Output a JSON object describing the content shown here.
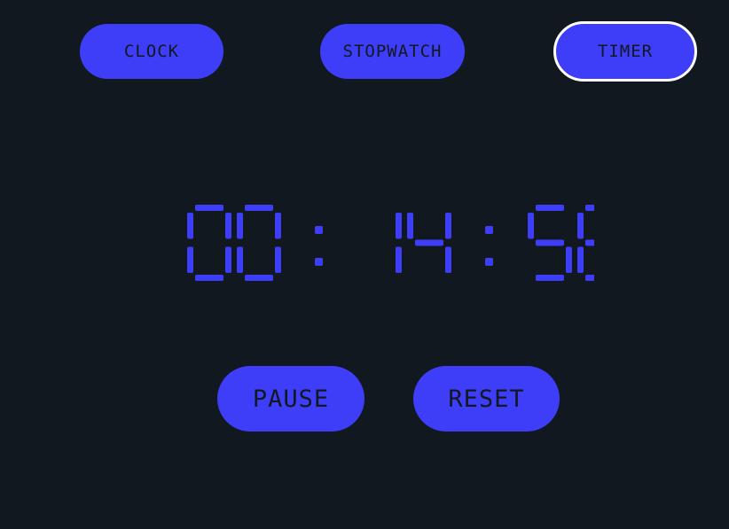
{
  "modes": {
    "clock_label": "CLOCK",
    "stopwatch_label": "STOPWATCH",
    "timer_label": "TIMER",
    "active": "timer"
  },
  "timer": {
    "display": "00:14:56"
  },
  "controls": {
    "pause_label": "PAUSE",
    "reset_label": "RESET"
  },
  "colors": {
    "background": "#111820",
    "accent": "#3e3ef8",
    "button_text": "#111820",
    "active_border": "#ffffff"
  }
}
